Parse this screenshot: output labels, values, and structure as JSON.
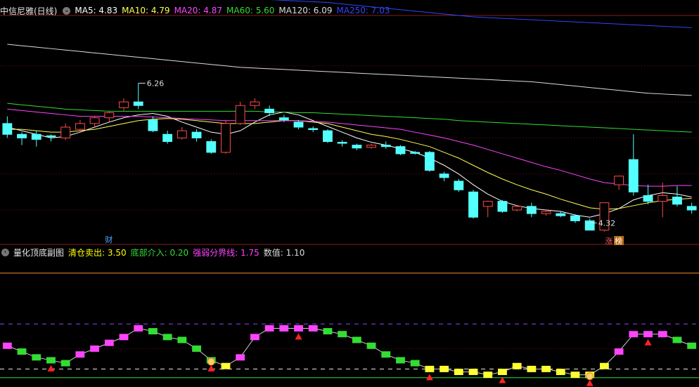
{
  "main_legend": {
    "title": "中信尼雅(日线)",
    "ma": [
      {
        "label": "MA5: 4.83",
        "color": "#ffffff"
      },
      {
        "label": "MA10: 4.79",
        "color": "#ffff55"
      },
      {
        "label": "MA20: 4.87",
        "color": "#ff44ff"
      },
      {
        "label": "MA60: 5.60",
        "color": "#33dd33"
      },
      {
        "label": "MA120: 6.09",
        "color": "#dddddd"
      },
      {
        "label": "MA250: 7.03",
        "color": "#3344ff"
      }
    ]
  },
  "sub_legend": {
    "title": "量化顶底副图",
    "items": [
      {
        "label": "清仓卖出: 3.50",
        "color": "#ffff00"
      },
      {
        "label": "底部介入: 0.20",
        "color": "#33dd33"
      },
      {
        "label": "强弱分界线: 1.75",
        "color": "#ff44ff"
      },
      {
        "label": "数值: 1.10",
        "color": "#dddddd"
      }
    ]
  },
  "markers": {
    "cai": "财",
    "zhang": "涨",
    "bang": "榜"
  },
  "chart_data": [
    {
      "type": "candlestick",
      "title": "中信尼雅(日线)",
      "ylim": [
        4.1,
        7.2
      ],
      "annotations": [
        {
          "label": "6.26",
          "value": 6.26
        },
        {
          "label": "4.32",
          "value": 4.32
        }
      ],
      "candles": [
        [
          5.7,
          5.8,
          5.55,
          5.5
        ],
        [
          5.55,
          5.58,
          5.5,
          5.4
        ],
        [
          5.55,
          5.6,
          5.48,
          5.38
        ],
        [
          5.53,
          5.55,
          5.52,
          5.45
        ],
        [
          5.5,
          5.7,
          5.65,
          5.47
        ],
        [
          5.62,
          5.75,
          5.7,
          5.58
        ],
        [
          5.7,
          5.8,
          5.78,
          5.65
        ],
        [
          5.78,
          5.88,
          5.85,
          5.72
        ],
        [
          5.92,
          6.05,
          6.0,
          5.88
        ],
        [
          6.0,
          6.26,
          5.95,
          5.9
        ],
        [
          5.75,
          5.8,
          5.6,
          5.58
        ],
        [
          5.55,
          5.6,
          5.45,
          5.42
        ],
        [
          5.5,
          5.65,
          5.6,
          5.48
        ],
        [
          5.58,
          5.62,
          5.5,
          5.45
        ],
        [
          5.45,
          5.48,
          5.3,
          5.28
        ],
        [
          5.3,
          5.75,
          5.7,
          5.28
        ],
        [
          5.7,
          6.0,
          5.95,
          5.68
        ],
        [
          5.95,
          6.05,
          6.0,
          5.9
        ],
        [
          5.9,
          5.95,
          5.85,
          5.8
        ],
        [
          5.78,
          5.82,
          5.75,
          5.72
        ],
        [
          5.72,
          5.75,
          5.65,
          5.62
        ],
        [
          5.63,
          5.66,
          5.62,
          5.58
        ],
        [
          5.6,
          5.62,
          5.45,
          5.43
        ],
        [
          5.44,
          5.47,
          5.43,
          5.38
        ],
        [
          5.4,
          5.42,
          5.36,
          5.33
        ],
        [
          5.37,
          5.42,
          5.4,
          5.35
        ],
        [
          5.4,
          5.45,
          5.38,
          5.35
        ],
        [
          5.38,
          5.4,
          5.28,
          5.26
        ],
        [
          5.3,
          5.32,
          5.29,
          5.27
        ],
        [
          5.3,
          5.32,
          5.05,
          5.03
        ],
        [
          5.0,
          5.03,
          4.95,
          4.9
        ],
        [
          4.9,
          4.93,
          4.78,
          4.75
        ],
        [
          4.75,
          4.78,
          4.4,
          4.38
        ],
        [
          4.55,
          4.63,
          4.62,
          4.4
        ],
        [
          4.62,
          4.64,
          4.48,
          4.46
        ],
        [
          4.5,
          4.57,
          4.55,
          4.48
        ],
        [
          4.55,
          4.6,
          4.45,
          4.4
        ],
        [
          4.45,
          4.5,
          4.48,
          4.42
        ],
        [
          4.45,
          4.48,
          4.42,
          4.4
        ],
        [
          4.42,
          4.44,
          4.35,
          4.32
        ],
        [
          4.35,
          4.38,
          4.22,
          4.32
        ],
        [
          4.22,
          4.6,
          4.6,
          4.2
        ],
        [
          4.85,
          4.98,
          4.97,
          4.78
        ],
        [
          5.2,
          5.55,
          4.75,
          4.7
        ],
        [
          4.7,
          4.85,
          4.62,
          4.58
        ],
        [
          4.62,
          4.88,
          4.7,
          4.4
        ],
        [
          4.68,
          4.83,
          4.58,
          4.55
        ],
        [
          4.55,
          4.6,
          4.5,
          4.45
        ]
      ],
      "ma_lines": {
        "MA5": [
          5.65,
          5.6,
          5.55,
          5.5,
          5.52,
          5.58,
          5.65,
          5.72,
          5.78,
          5.82,
          5.84,
          5.8,
          5.72,
          5.65,
          5.58,
          5.55,
          5.6,
          5.72,
          5.82,
          5.86,
          5.82,
          5.74,
          5.66,
          5.58,
          5.5,
          5.44,
          5.4,
          5.35,
          5.3,
          5.22,
          5.12,
          5.0,
          4.85,
          4.72,
          4.62,
          4.56,
          4.52,
          4.5,
          4.48,
          4.43,
          4.4,
          4.45,
          4.52,
          4.64,
          4.7,
          4.74,
          4.72,
          4.68
        ],
        "MA10": [
          5.62,
          5.62,
          5.6,
          5.58,
          5.58,
          5.6,
          5.62,
          5.66,
          5.7,
          5.74,
          5.76,
          5.77,
          5.76,
          5.74,
          5.72,
          5.7,
          5.7,
          5.7,
          5.72,
          5.74,
          5.74,
          5.72,
          5.7,
          5.65,
          5.6,
          5.55,
          5.52,
          5.48,
          5.43,
          5.38,
          5.3,
          5.22,
          5.12,
          5.02,
          4.93,
          4.85,
          4.78,
          4.72,
          4.65,
          4.59,
          4.53,
          4.51,
          4.52,
          4.56,
          4.6,
          4.63,
          4.65,
          4.66
        ],
        "MA20": [
          5.9,
          5.88,
          5.86,
          5.84,
          5.82,
          5.8,
          5.8,
          5.8,
          5.8,
          5.8,
          5.79,
          5.78,
          5.77,
          5.76,
          5.75,
          5.74,
          5.74,
          5.74,
          5.74,
          5.74,
          5.74,
          5.73,
          5.72,
          5.7,
          5.68,
          5.66,
          5.64,
          5.62,
          5.58,
          5.54,
          5.5,
          5.45,
          5.4,
          5.34,
          5.28,
          5.22,
          5.16,
          5.1,
          5.05,
          4.99,
          4.93,
          4.88,
          4.86,
          4.84,
          4.83,
          4.83,
          4.84,
          4.84
        ],
        "MA60": [
          5.98,
          5.96,
          5.94,
          5.92,
          5.9,
          5.89,
          5.88,
          5.87,
          5.87,
          5.87,
          5.87,
          5.87,
          5.87,
          5.87,
          5.87,
          5.87,
          5.87,
          5.87,
          5.86,
          5.86,
          5.85,
          5.85,
          5.84,
          5.83,
          5.82,
          5.81,
          5.8,
          5.79,
          5.78,
          5.77,
          5.76,
          5.74,
          5.73,
          5.72,
          5.71,
          5.7,
          5.69,
          5.68,
          5.67,
          5.66,
          5.65,
          5.64,
          5.63,
          5.62,
          5.61,
          5.6,
          5.59,
          5.58
        ],
        "MA120": [
          6.8,
          6.78,
          6.76,
          6.74,
          6.72,
          6.7,
          6.68,
          6.66,
          6.64,
          6.62,
          6.6,
          6.58,
          6.56,
          6.54,
          6.52,
          6.5,
          6.48,
          6.47,
          6.46,
          6.45,
          6.44,
          6.43,
          6.42,
          6.41,
          6.4,
          6.39,
          6.38,
          6.37,
          6.36,
          6.35,
          6.34,
          6.33,
          6.32,
          6.31,
          6.3,
          6.29,
          6.28,
          6.26,
          6.24,
          6.22,
          6.2,
          6.18,
          6.16,
          6.14,
          6.12,
          6.11,
          6.1,
          6.09
        ],
        "MA250": [
          7.6,
          7.59,
          7.58,
          7.57,
          7.56,
          7.55,
          7.54,
          7.53,
          7.52,
          7.51,
          7.5,
          7.49,
          7.48,
          7.47,
          7.46,
          7.45,
          7.44,
          7.43,
          7.42,
          7.41,
          7.4,
          7.39,
          7.38,
          7.36,
          7.34,
          7.32,
          7.3,
          7.28,
          7.26,
          7.24,
          7.22,
          7.2,
          7.18,
          7.17,
          7.16,
          7.15,
          7.14,
          7.13,
          7.12,
          7.11,
          7.1,
          7.09,
          7.08,
          7.07,
          7.06,
          7.05,
          7.04,
          7.03
        ]
      }
    },
    {
      "type": "bar",
      "title": "量化顶底副图",
      "ylim": [
        -0.3,
        4.2
      ],
      "reference_lines": [
        {
          "name": "清仓卖出",
          "value": 3.5
        },
        {
          "name": "强弱分界线",
          "value": 1.75
        },
        {
          "name": "底部介入",
          "value": 0.2
        }
      ],
      "values": [
        1.0,
        0.8,
        0.6,
        0.5,
        0.4,
        0.7,
        0.9,
        1.1,
        1.3,
        1.6,
        1.5,
        1.3,
        1.2,
        0.9,
        0.5,
        0.3,
        0.6,
        1.3,
        1.6,
        1.6,
        1.6,
        1.6,
        1.5,
        1.4,
        1.2,
        1.0,
        0.7,
        0.5,
        0.4,
        0.2,
        0.2,
        0.1,
        0.1,
        0.0,
        0.1,
        0.3,
        0.2,
        0.2,
        0.1,
        0.0,
        0.0,
        0.3,
        0.8,
        1.4,
        1.4,
        1.4,
        1.2,
        1.0
      ],
      "buy_signals": [
        3,
        14,
        29,
        34,
        40
      ],
      "sell_signals": [
        20,
        44
      ],
      "hand_signals": [
        14,
        40
      ]
    }
  ]
}
